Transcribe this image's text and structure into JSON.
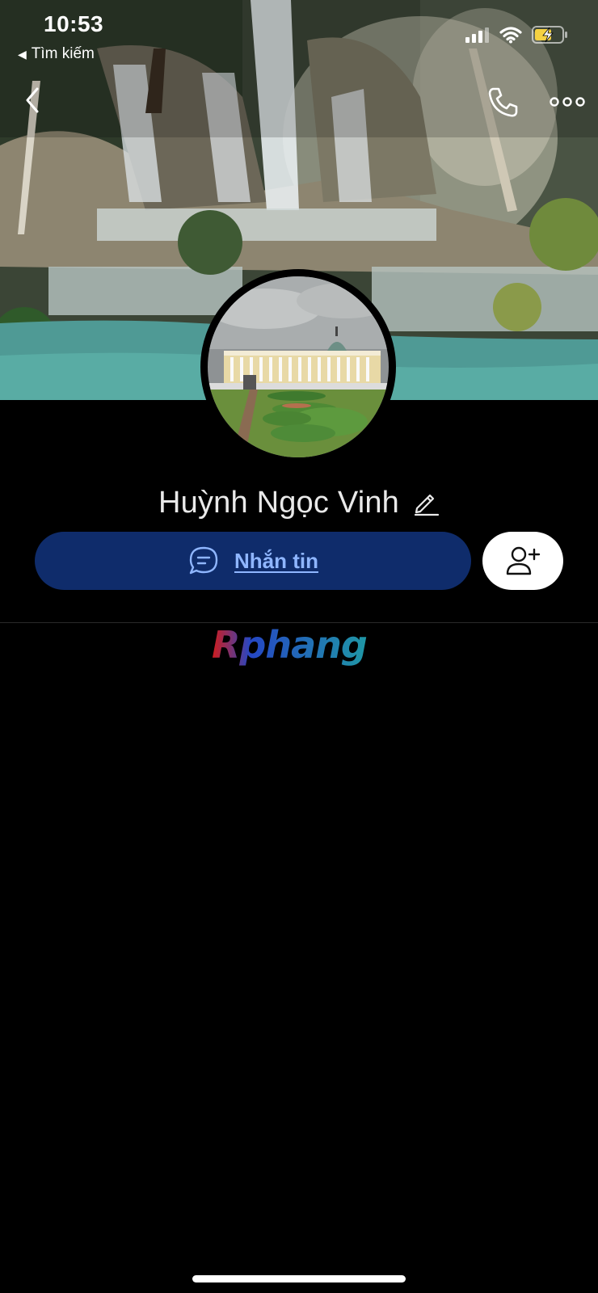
{
  "status_bar": {
    "time": "10:53",
    "back_to_app": "Tìm kiếm"
  },
  "nav": {
    "back_icon": "chevron-left-icon",
    "call_icon": "phone-icon",
    "more_icon": "more-horizontal-icon"
  },
  "profile": {
    "name": "Huỳnh Ngọc Vinh",
    "edit_icon": "pencil-icon"
  },
  "actions": {
    "message_label": "Nhắn tin",
    "message_icon": "chat-bubble-icon",
    "add_friend_icon": "user-plus-icon"
  },
  "watermark": {
    "text": "Rphang"
  },
  "colors": {
    "background": "#000000",
    "message_button_bg": "#0f2c6b",
    "message_label": "#8fb6ff",
    "add_friend_bg": "#ffffff",
    "battery_fill": "#f5d142"
  }
}
